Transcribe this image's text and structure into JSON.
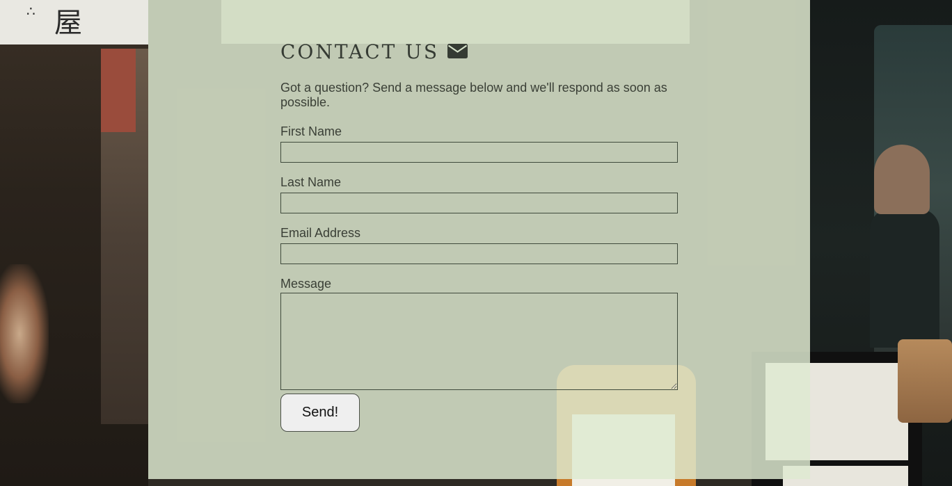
{
  "page": {
    "heading": "CONTACT US",
    "heading_icon": "envelope-icon",
    "intro_text": "Got a question? Send a message below and we'll respond as soon as possible."
  },
  "form": {
    "first_name": {
      "label": "First Name",
      "value": ""
    },
    "last_name": {
      "label": "Last Name",
      "value": ""
    },
    "email": {
      "label": "Email Address",
      "value": ""
    },
    "message": {
      "label": "Message",
      "value": ""
    },
    "submit_label": "Send!"
  },
  "colors": {
    "panel_background": "#deead0",
    "text": "#3a3f36",
    "button_background": "#efefef"
  }
}
